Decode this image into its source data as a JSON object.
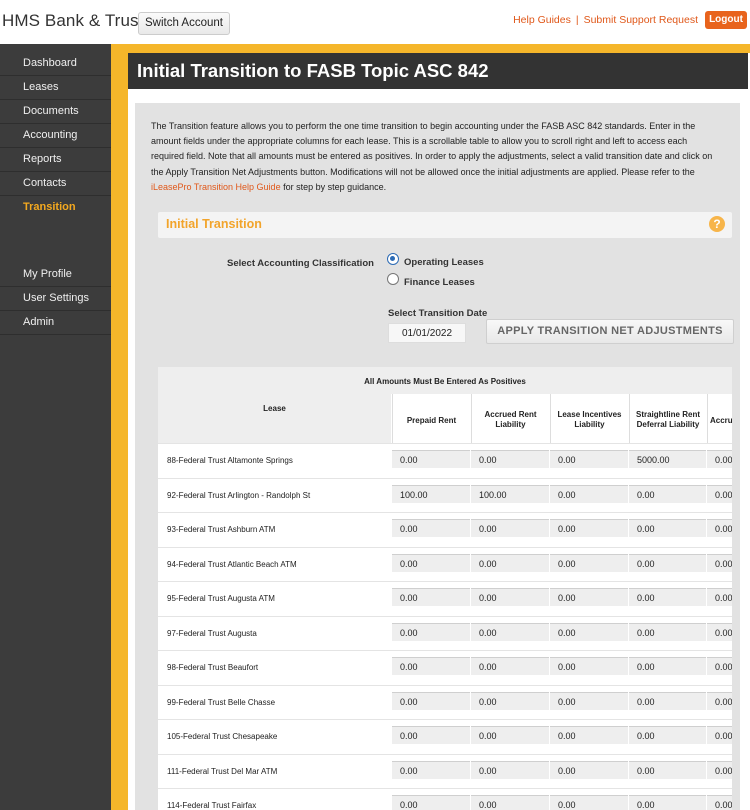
{
  "header": {
    "brand": "HMS Bank & Trust",
    "switch_account": "Switch Account",
    "help_guides": "Help Guides",
    "separator": "|",
    "support": "Submit Support Request",
    "logout": "Logout"
  },
  "sidebar": {
    "items": [
      {
        "label": "Dashboard"
      },
      {
        "label": "Leases"
      },
      {
        "label": "Documents"
      },
      {
        "label": "Accounting"
      },
      {
        "label": "Reports"
      },
      {
        "label": "Contacts"
      },
      {
        "label": "Transition"
      },
      {
        "label": "My Profile"
      },
      {
        "label": "User Settings"
      },
      {
        "label": "Admin"
      }
    ],
    "active": "Transition"
  },
  "page": {
    "title": "Initial Transition to FASB Topic ASC 842",
    "intro_text": "The Transition feature allows you to perform the one time transition to begin accounting under the FASB ASC 842 standards. Enter in the amount fields under the appropriate columns for each lease. This is a scrollable table to allow you to scroll right and left to access each required field. Note that all amounts must be entered as positives. In order to apply the adjustments, select a valid transition date and click on the Apply Transition Net Adjustments button. Modifications will not be allowed once the initial adjustments are applied. Please refer to the ",
    "intro_link": "iLeasePro Transition Help Guide",
    "intro_suffix": " for step by step guidance.",
    "section_title": "Initial Transition",
    "help_symbol": "?",
    "classification_label": "Select Accounting Classification",
    "option_operating": "Operating Leases",
    "option_finance": "Finance Leases",
    "selected_option": "Operating Leases",
    "date_label": "Select Transition Date",
    "date_value": "01/01/2022",
    "apply_button": "APPLY TRANSITION NET ADJUSTMENTS"
  },
  "table": {
    "caption": "All Amounts Must Be Entered As Positives",
    "headers": {
      "lease": "Lease",
      "prepaid": "Prepaid Rent",
      "accrued_line1": "Accrued Rent",
      "accrued_line2": "Liability",
      "incentives_line1": "Lease Incentives",
      "incentives_line2": "Liability",
      "straightline_line1": "Straightline Rent",
      "straightline_line2": "Deferral Liability",
      "partial": "Accrue"
    },
    "rows": [
      {
        "lease": "88-Federal Trust Altamonte Springs",
        "prepaid": "0.00",
        "accrued": "0.00",
        "incentives": "0.00",
        "straightline": "5000.00",
        "next": "0.00"
      },
      {
        "lease": "92-Federal Trust Arlington - Randolph St",
        "prepaid": "100.00",
        "accrued": "100.00",
        "incentives": "0.00",
        "straightline": "0.00",
        "next": "0.00"
      },
      {
        "lease": "93-Federal Trust Ashburn ATM",
        "prepaid": "0.00",
        "accrued": "0.00",
        "incentives": "0.00",
        "straightline": "0.00",
        "next": "0.00"
      },
      {
        "lease": "94-Federal Trust Atlantic Beach ATM",
        "prepaid": "0.00",
        "accrued": "0.00",
        "incentives": "0.00",
        "straightline": "0.00",
        "next": "0.00"
      },
      {
        "lease": "95-Federal Trust Augusta ATM",
        "prepaid": "0.00",
        "accrued": "0.00",
        "incentives": "0.00",
        "straightline": "0.00",
        "next": "0.00"
      },
      {
        "lease": "97-Federal Trust Augusta",
        "prepaid": "0.00",
        "accrued": "0.00",
        "incentives": "0.00",
        "straightline": "0.00",
        "next": "0.00"
      },
      {
        "lease": "98-Federal Trust Beaufort",
        "prepaid": "0.00",
        "accrued": "0.00",
        "incentives": "0.00",
        "straightline": "0.00",
        "next": "0.00"
      },
      {
        "lease": "99-Federal Trust Belle Chasse",
        "prepaid": "0.00",
        "accrued": "0.00",
        "incentives": "0.00",
        "straightline": "0.00",
        "next": "0.00"
      },
      {
        "lease": "105-Federal Trust Chesapeake",
        "prepaid": "0.00",
        "accrued": "0.00",
        "incentives": "0.00",
        "straightline": "0.00",
        "next": "0.00"
      },
      {
        "lease": "111-Federal Trust Del Mar ATM",
        "prepaid": "0.00",
        "accrued": "0.00",
        "incentives": "0.00",
        "straightline": "0.00",
        "next": "0.00"
      },
      {
        "lease": "114-Federal Trust Fairfax",
        "prepaid": "0.00",
        "accrued": "0.00",
        "incentives": "0.00",
        "straightline": "0.00",
        "next": "0.00"
      }
    ]
  },
  "colors": {
    "accent": "#f5b62a",
    "link": "#e0581a",
    "sidebar_bg": "#3c3c3c",
    "title_bar_bg": "#333333"
  }
}
